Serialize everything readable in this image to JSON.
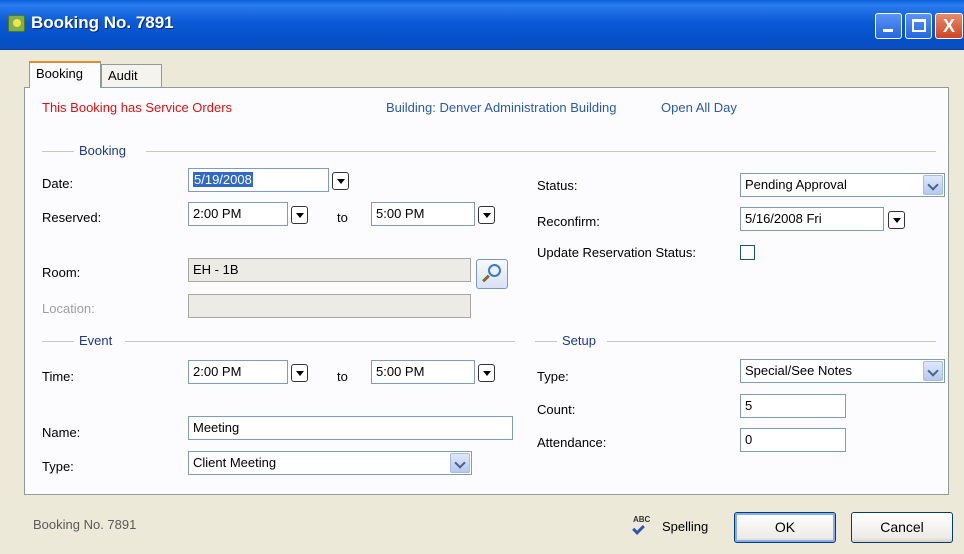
{
  "window": {
    "title": "Booking No. 7891",
    "close_glyph": "X"
  },
  "tabs": [
    {
      "label": "Booking",
      "active": true
    },
    {
      "label": "Audit",
      "active": false
    }
  ],
  "notices": {
    "service_orders": "This Booking has Service Orders",
    "building": "Building: Denver Administration Building",
    "hours": "Open All Day"
  },
  "booking": {
    "group_title": "Booking",
    "date_label": "Date:",
    "date_value": "5/19/2008",
    "reserved_label": "Reserved:",
    "reserved_start": "2:00 PM",
    "to_label": "to",
    "reserved_end": "5:00 PM",
    "room_label": "Room:",
    "room_value": "EH - 1B",
    "location_label": "Location:",
    "location_value": "",
    "status_label": "Status:",
    "status_value": "Pending Approval",
    "reconfirm_label": "Reconfirm:",
    "reconfirm_value": "5/16/2008 Fri",
    "update_status_label": "Update Reservation Status:",
    "update_status_checked": false
  },
  "event": {
    "group_title": "Event",
    "time_label": "Time:",
    "time_start": "2:00 PM",
    "to_label": "to",
    "time_end": "5:00 PM",
    "name_label": "Name:",
    "name_value": "Meeting",
    "type_label": "Type:",
    "type_value": "Client Meeting"
  },
  "setup": {
    "group_title": "Setup",
    "type_label": "Type:",
    "type_value": "Special/See Notes",
    "count_label": "Count:",
    "count_value": "5",
    "attendance_label": "Attendance:",
    "attendance_value": "0"
  },
  "footer": {
    "status_text": "Booking No. 7891",
    "spelling_label": "Spelling",
    "spell_icon_text": "ABC",
    "ok_label": "OK",
    "cancel_label": "Cancel"
  },
  "colors": {
    "title_bar": "#0b59d5",
    "notice_red": "#e01010",
    "notice_blue": "#2b5aa8",
    "group_title": "#1c3a8c"
  }
}
